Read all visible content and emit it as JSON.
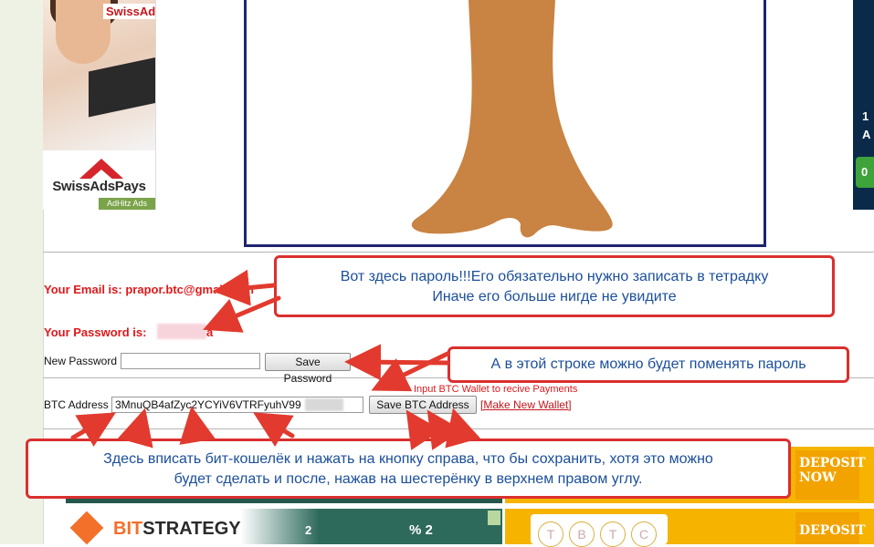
{
  "ads": {
    "left_brand_top": "SwissAds",
    "left_brand": "SwissAdsPays",
    "left_sub": "AdHitz Ads",
    "right_text_1": "1",
    "right_text_2": "A",
    "right_text_3": "0"
  },
  "account": {
    "email_label": "Your Email is: prapor.btc@gmail.com",
    "password_label": "Your Password is:",
    "password_tail": "a",
    "new_password_label": "New Password",
    "new_password_value": "",
    "save_password_button": "Save Password",
    "btc_hint": "Input BTC Wallet to recive Payments",
    "btc_label": "BTC Address",
    "btc_value": "3MnuQB4afZyc2YCYiV6VTRFyuhV99",
    "save_btc_button": "Save BTC Address",
    "make_wallet_link": "[Make New Wallet]"
  },
  "callouts": {
    "password_note_line1": "Вот здесь пароль!!!Его обязательно нужно записать в тетрадку",
    "password_note_line2": "Иначе его больше нигде не увидите",
    "change_note": "А в этой строке можно будет поменять пароль",
    "btc_note_line1": "Здесь вписать бит-кошелёк и нажать на кнопку справа, что бы сохранить, хотя это можно",
    "btc_note_line2": "будет сделать и после, нажав на шестерёнку в верхнем правом углу."
  },
  "banners": {
    "strategy_brand_bit": "BIT",
    "strategy_brand_rest": "STRATEGY",
    "strategy_num_left": "2",
    "strategy_num_right": "% 2",
    "coins": [
      "T",
      "B",
      "T",
      "C"
    ],
    "deposit_label_1": "DEPOSIT",
    "deposit_label_2": "NOW"
  },
  "colors": {
    "accent_red": "#e0181b",
    "callout_border": "#d9302e",
    "callout_text": "#1b4f9a",
    "frame_navy": "#1f2470",
    "trunk": "#c98342",
    "deposit_yellow": "#f6b400"
  }
}
